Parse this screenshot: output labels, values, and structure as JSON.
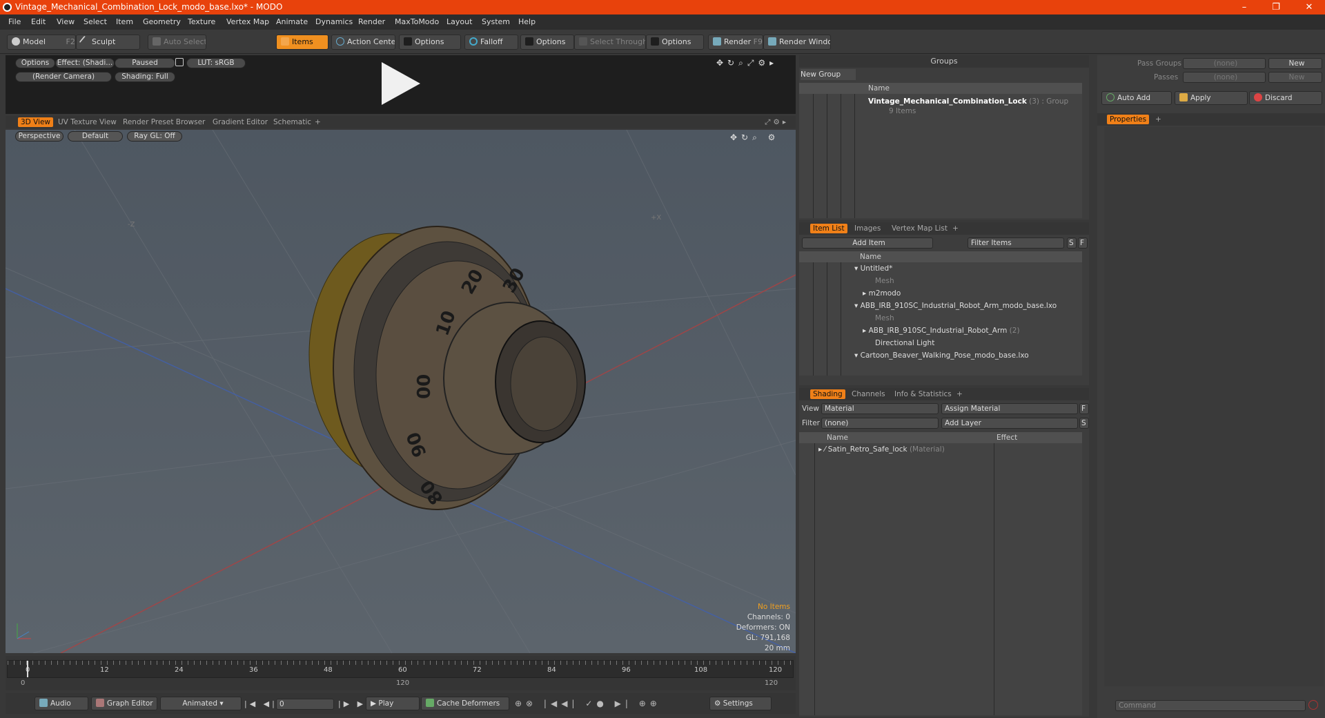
{
  "window": {
    "title": "Vintage_Mechanical_Combination_Lock_modo_base.lxo* - MODO",
    "minimize": "–",
    "restore": "❐",
    "close": "✕"
  },
  "menu": [
    "File",
    "Edit",
    "View",
    "Select",
    "Item",
    "Geometry",
    "Texture",
    "Vertex Map",
    "Animate",
    "Dynamics",
    "Render",
    "MaxToModo",
    "Layout",
    "System",
    "Help"
  ],
  "toolbar": {
    "model": "Model",
    "model_key": "F2",
    "sculpt": "Sculpt",
    "auto_select": "Auto Select",
    "items": "Items",
    "action_center": "Action Center",
    "options1": "Options",
    "falloff": "Falloff",
    "options2": "Options",
    "select_through": "Select Through",
    "options3": "Options",
    "render": "Render",
    "render_key": "F9",
    "render_window": "Render Window"
  },
  "preview": {
    "options": "Options",
    "effect": "Effect: (Shadi...",
    "paused": "Paused",
    "lut": "LUT: sRGB",
    "camera": "(Render Camera)",
    "shading": "Shading: Full"
  },
  "viewport_tabs": [
    "3D View",
    "UV Texture View",
    "Render Preset Browser",
    "Gradient Editor",
    "Schematic",
    "+"
  ],
  "viewport": {
    "perspective": "Perspective",
    "default": "Default",
    "raygl": "Ray GL: Off",
    "axis_z": "-Z",
    "axis_x": "+X",
    "info": {
      "no_items": "No Items",
      "channels": "Channels: 0",
      "deformers": "Deformers: ON",
      "gl": "GL: 791,168",
      "scale": "20 mm"
    },
    "dial_numbers": [
      "20",
      "30",
      "10",
      "00",
      "90",
      "80"
    ]
  },
  "timeline": {
    "ticks": [
      "0",
      "12",
      "24",
      "36",
      "48",
      "60",
      "72",
      "84",
      "96",
      "108",
      "120"
    ],
    "bottom_left": "0",
    "bottom_mid": "120",
    "bottom_right": "120"
  },
  "bottombar": {
    "audio": "Audio",
    "graph_editor": "Graph Editor",
    "animated": "Animated",
    "frame": "0",
    "play": "Play",
    "cache_deformers": "Cache Deformers",
    "settings": "Settings"
  },
  "groups": {
    "title": "Groups",
    "new_group": "New Group",
    "col_name": "Name",
    "item_name": "Vintage_Mechanical_Combination_Lock",
    "item_count": "(3)",
    "item_type": ": Group",
    "item_sub": "9 Items"
  },
  "item_list": {
    "tabs": [
      "Item List",
      "Images",
      "Vertex Map List",
      "+"
    ],
    "add_item": "Add Item",
    "filter_items": "Filter Items",
    "s": "S",
    "f": "F",
    "col_name": "Name",
    "rows": [
      {
        "label": "Untitled*",
        "dim": false
      },
      {
        "label": "Mesh",
        "dim": true
      },
      {
        "label": "m2modo",
        "dim": false
      },
      {
        "label": "ABB_IRB_910SC_Industrial_Robot_Arm_modo_base.lxo",
        "dim": false
      },
      {
        "label": "Mesh",
        "dim": true
      },
      {
        "label": "ABB_IRB_910SC_Industrial_Robot_Arm",
        "dim": false
      },
      {
        "label": "Directional Light",
        "dim": false
      },
      {
        "label": "Cartoon_Beaver_Walking_Pose_modo_base.lxo",
        "dim": false
      }
    ],
    "robot_count": "(2)"
  },
  "shading": {
    "tabs": [
      "Shading",
      "Channels",
      "Info & Statistics",
      "+"
    ],
    "view_label": "View",
    "view_value": "Material",
    "assign_material": "Assign Material",
    "f": "F",
    "filter_label": "Filter",
    "filter_value": "(none)",
    "add_layer": "Add Layer",
    "s": "S",
    "col_name": "Name",
    "col_effect": "Effect",
    "material_name": "Satin_Retro_Safe_lock",
    "material_type": "(Material)"
  },
  "right": {
    "pass_groups": "Pass Groups",
    "passes": "Passes",
    "none1": "(none)",
    "none2": "(none)",
    "new1": "New",
    "new2": "New",
    "auto_add": "Auto Add",
    "apply": "Apply",
    "discard": "Discard",
    "properties": "Properties",
    "plus": "+",
    "command": "Command"
  }
}
